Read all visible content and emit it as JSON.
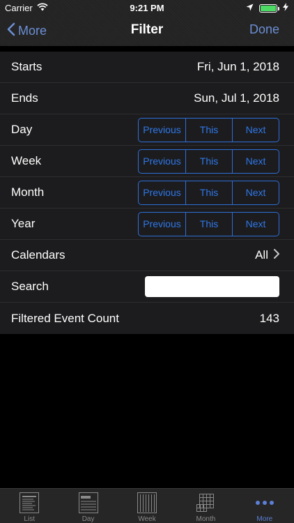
{
  "status": {
    "carrier": "Carrier",
    "time": "9:21 PM"
  },
  "nav": {
    "back_label": "More",
    "title": "Filter",
    "done_label": "Done"
  },
  "rows": {
    "starts": {
      "label": "Starts",
      "value": "Fri, Jun 1, 2018"
    },
    "ends": {
      "label": "Ends",
      "value": "Sun, Jul 1, 2018"
    },
    "day": {
      "label": "Day"
    },
    "week": {
      "label": "Week"
    },
    "month": {
      "label": "Month"
    },
    "year": {
      "label": "Year"
    },
    "calendars": {
      "label": "Calendars",
      "value": "All"
    },
    "search": {
      "label": "Search",
      "value": "",
      "placeholder": ""
    },
    "count": {
      "label": "Filtered Event Count",
      "value": "143"
    }
  },
  "segments": {
    "previous": "Previous",
    "this": "This",
    "next": "Next"
  },
  "tabs": [
    {
      "label": "List",
      "icon": "list-icon"
    },
    {
      "label": "Day",
      "icon": "day-icon"
    },
    {
      "label": "Week",
      "icon": "week-icon"
    },
    {
      "label": "Month",
      "icon": "month-icon"
    },
    {
      "label": "More",
      "icon": "more-icon",
      "active": true
    }
  ],
  "colors": {
    "accent": "#2f77e8",
    "nav_accent": "#6c8fd6",
    "battery": "#4cd964",
    "active_tab": "#5b7fd6"
  }
}
